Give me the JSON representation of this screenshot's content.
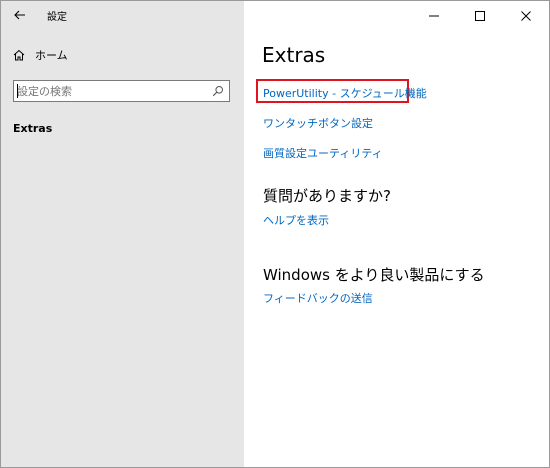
{
  "window": {
    "title": "設定",
    "controls": {
      "minimize": "minimize-icon",
      "maximize": "maximize-icon",
      "close": "close-icon"
    }
  },
  "sidebar": {
    "home_label": "ホーム",
    "search_placeholder": "設定の検索",
    "nav_items": [
      {
        "label": "Extras",
        "selected": true
      }
    ]
  },
  "main": {
    "title": "Extras",
    "links": [
      {
        "label": "PowerUtility - スケジュール機能",
        "highlighted": true
      },
      {
        "label": "ワンタッチボタン設定"
      },
      {
        "label": "画質設定ユーティリティ"
      }
    ],
    "help_section": {
      "title": "質問がありますか?",
      "link": "ヘルプを表示"
    },
    "feedback_section": {
      "title": "Windows をより良い製品にする",
      "link": "フィードバックの送信"
    }
  },
  "colors": {
    "sidebar_bg": "#e6e6e6",
    "link": "#0067c0",
    "highlight_border": "#e0141e"
  }
}
